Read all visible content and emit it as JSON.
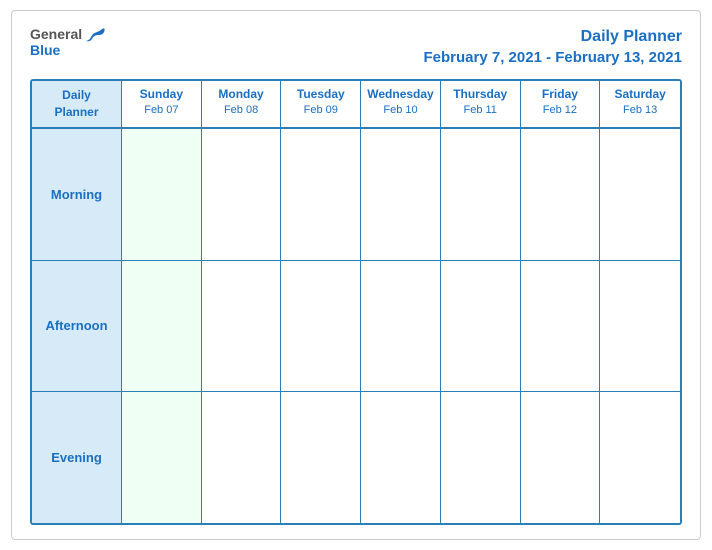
{
  "header": {
    "logo_general": "General",
    "logo_blue": "Blue",
    "title": "Daily Planner",
    "date_range": "February 7, 2021 - February 13, 2021"
  },
  "columns": [
    {
      "id": "label",
      "day": "Daily",
      "day2": "Planner",
      "date": ""
    },
    {
      "id": "sun",
      "day": "Sunday",
      "date": "Feb 07"
    },
    {
      "id": "mon",
      "day": "Monday",
      "date": "Feb 08"
    },
    {
      "id": "tue",
      "day": "Tuesday",
      "date": "Feb 09"
    },
    {
      "id": "wed",
      "day": "Wednesday",
      "date": "Feb 10"
    },
    {
      "id": "thu",
      "day": "Thursday",
      "date": "Feb 11"
    },
    {
      "id": "fri",
      "day": "Friday",
      "date": "Feb 12"
    },
    {
      "id": "sat",
      "day": "Saturday",
      "date": "Feb 13"
    }
  ],
  "rows": [
    {
      "label": "Morning"
    },
    {
      "label": "Afternoon"
    },
    {
      "label": "Evening"
    }
  ]
}
